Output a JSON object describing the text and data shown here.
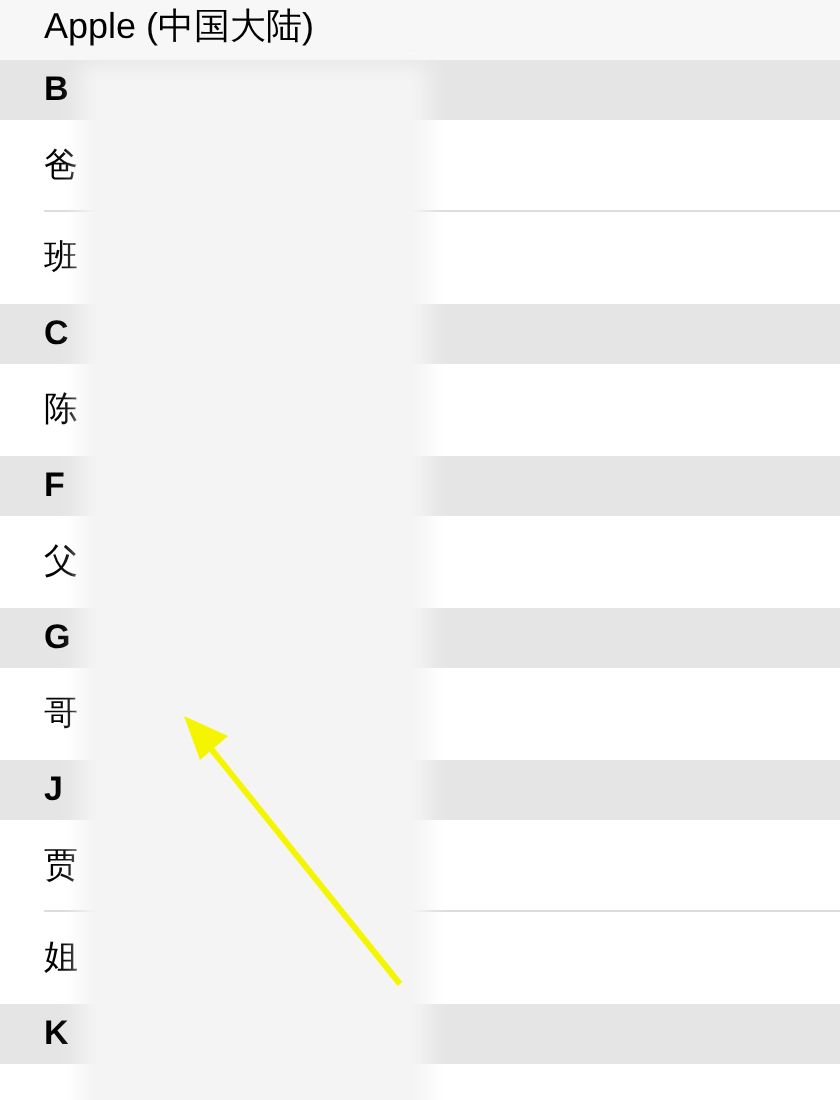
{
  "account": "Apple (中国大陆)",
  "sections": [
    {
      "letter": "B",
      "contacts": [
        "爸",
        "班"
      ]
    },
    {
      "letter": "C",
      "contacts": [
        "陈"
      ]
    },
    {
      "letter": "F",
      "contacts": [
        "父"
      ]
    },
    {
      "letter": "G",
      "contacts": [
        "哥"
      ]
    },
    {
      "letter": "J",
      "contacts": [
        "贾",
        "姐"
      ]
    },
    {
      "letter": "K"
    }
  ]
}
